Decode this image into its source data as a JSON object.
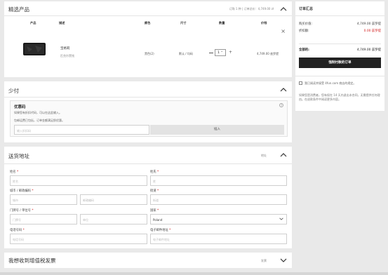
{
  "products": {
    "title": "精选产品",
    "summary": "订购 1 种 | 订单总价：4,749.00 zł",
    "headers": {
      "product": "产品",
      "description": "描述",
      "color": "颜色",
      "size": "尺寸",
      "quantity": "数量",
      "price": "价钱"
    },
    "item": {
      "name": "宝格莉",
      "sub": "匹克尔黑钱",
      "color": "黑色(2)",
      "size": "默认 / 均码",
      "quantity": "1",
      "price": "4,749.00 兹罗提"
    },
    "remove": "×"
  },
  "coupon": {
    "title": "少付",
    "box_title": "优惠码",
    "line1": "如果您有折扣代码，可以在这此输入。",
    "line2": "包邮运费已包括，订单金额满足即优惠。",
    "placeholder": "输入折扣码",
    "apply": "插入"
  },
  "shipping": {
    "title": "送货地址",
    "hint": "地址",
    "fields": {
      "first_name": {
        "label": "姓名",
        "placeholder": "姓名"
      },
      "last_name": {
        "label": "姓氏",
        "placeholder": "姓"
      },
      "city": {
        "label": "城市 / 邮政编码",
        "placeholder": "城市",
        "placeholder2": "邮政编码"
      },
      "street": {
        "label": "街道",
        "placeholder": "街道"
      },
      "house": {
        "label": "门牌号 / 单位号",
        "placeholder": "门牌号",
        "placeholder2": "单位"
      },
      "country": {
        "label": "国家",
        "value": "Poland"
      },
      "phone": {
        "label": "电话号码",
        "placeholder": "电话号码"
      },
      "email": {
        "label": "电子邮件地址",
        "placeholder": "电子邮件地址"
      }
    },
    "required_mark": "*"
  },
  "invoice": {
    "title": "我想收到增值税发票",
    "hint": "发票"
  },
  "summary": {
    "title": "订单汇总",
    "rows": [
      {
        "label": "购买价值:",
        "value": "4,749.00 兹罗提",
        "red": false
      },
      {
        "label": "折扣额:",
        "value": "0.00 兹罗提",
        "red": true
      }
    ],
    "total_label": "全部的:",
    "total_value": "4,749.00 兹罗提",
    "pay_button": "强制付款的订单",
    "consent": "我已阅读并接受 4fun.com 商店的规定。",
    "note": "如果您是消费者，您有权在 14 天内退出本合同，无需提供任何理由。在退款条件中阅读更多内容。"
  },
  "colors": {
    "accent": "#d21f1f",
    "dark": "#222222"
  }
}
